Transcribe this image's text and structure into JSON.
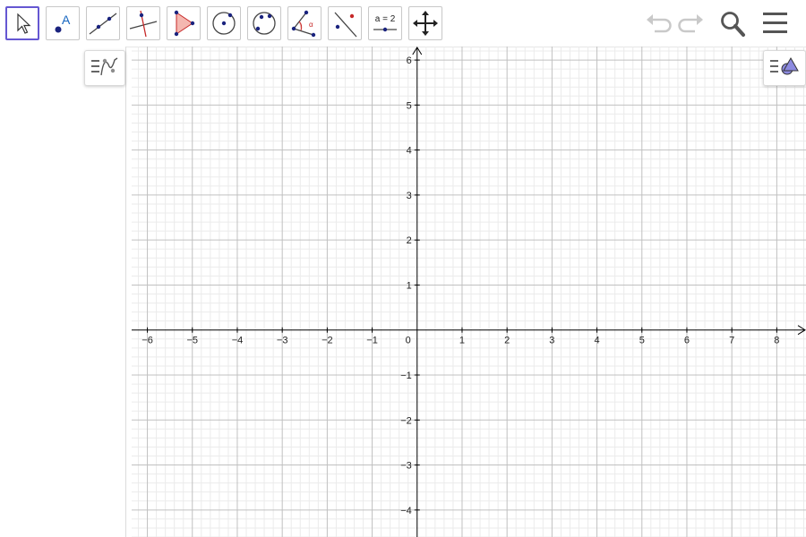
{
  "toolbar": {
    "tools": [
      {
        "name": "move-tool",
        "selected": true
      },
      {
        "name": "point-tool",
        "label": "A"
      },
      {
        "name": "line-tool"
      },
      {
        "name": "perpendicular-line-tool"
      },
      {
        "name": "polygon-tool"
      },
      {
        "name": "circle-center-point-tool"
      },
      {
        "name": "circle-three-points-tool"
      },
      {
        "name": "angle-tool",
        "label": "α"
      },
      {
        "name": "reflect-about-line-tool"
      },
      {
        "name": "slider-tool",
        "label": "a = 2"
      },
      {
        "name": "move-graphics-view-tool"
      }
    ],
    "right_icons": [
      "undo-icon",
      "redo-icon",
      "search-icon",
      "menu-icon"
    ]
  },
  "graphics_view": {
    "x_ticks": [
      "−6",
      "−5",
      "−4",
      "−3",
      "−2",
      "−1",
      "1",
      "2",
      "3",
      "4",
      "5",
      "6",
      "7",
      "8"
    ],
    "y_ticks_positive": [
      "6",
      "5",
      "4",
      "3",
      "2",
      "1"
    ],
    "y_ticks_negative": [
      "−1",
      "−2",
      "−3",
      "−4"
    ],
    "origin_label": "0",
    "xlim": [
      -6.35,
      8.65
    ],
    "ylim": [
      -4.6,
      6.3
    ],
    "grid": true,
    "colors": {
      "major_grid": "#c0c0c0",
      "minor_grid": "#ebebeb",
      "axis": "#000000",
      "accent": "#6557d2"
    }
  }
}
